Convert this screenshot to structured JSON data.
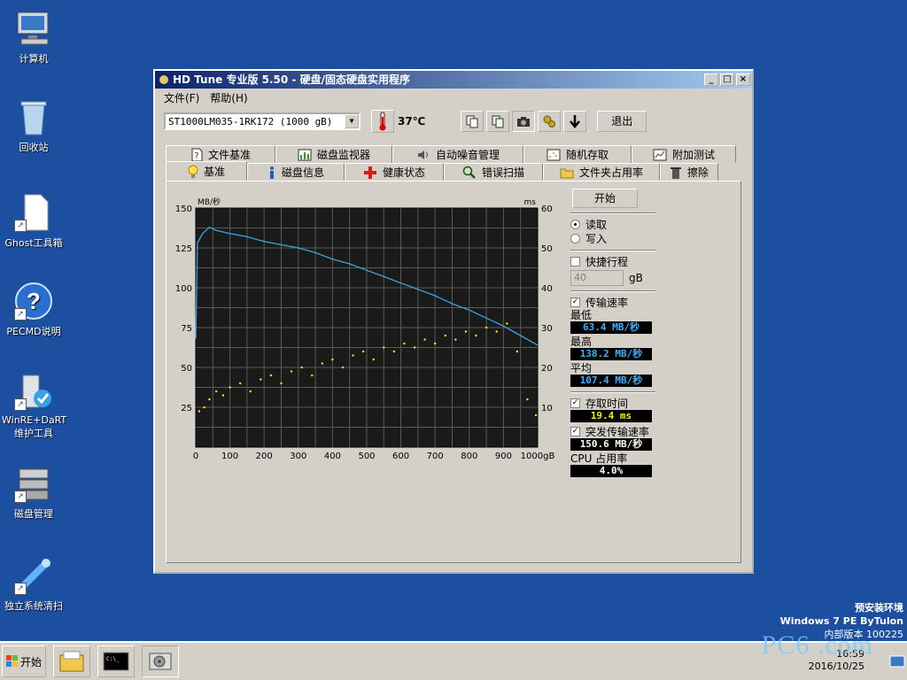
{
  "desktop": {
    "icons": [
      {
        "label": "计算机"
      },
      {
        "label": "回收站"
      },
      {
        "label": "Ghost工具箱"
      },
      {
        "label": "PECMD说明"
      },
      {
        "label": "WinRE+DaRT\n维护工具"
      },
      {
        "label": "磁盘管理"
      },
      {
        "label": "独立系统清扫"
      }
    ]
  },
  "window": {
    "title": "HD Tune 专业版 5.50 - 硬盘/固态硬盘实用程序",
    "menu": [
      "文件(F)",
      "帮助(H)"
    ],
    "drive": "ST1000LM035-1RK172 (1000 gB)",
    "temperature": "37℃",
    "exit_label": "退出",
    "tabs_row1": [
      "文件基准",
      "磁盘监视器",
      "自动噪音管理",
      "随机存取",
      "附加测试"
    ],
    "tabs_row2": [
      "基准",
      "磁盘信息",
      "健康状态",
      "错误扫描",
      "文件夹占用率",
      "擦除"
    ],
    "side": {
      "start_label": "开始",
      "read_label": "读取",
      "write_label": "写入",
      "quick_label": "快捷行程",
      "quick_value": "40",
      "quick_unit": "gB",
      "transfer_label": "传输速率",
      "min_label": "最低",
      "min_value": "63.4 MB/秒",
      "max_label": "最高",
      "max_value": "138.2 MB/秒",
      "avg_label": "平均",
      "avg_value": "107.4 MB/秒",
      "access_label": "存取时间",
      "access_value": "19.4 ms",
      "burst_label": "突发传输速率",
      "burst_value": "150.6 MB/秒",
      "cpu_label": "CPU 占用率",
      "cpu_value": "4.0%"
    }
  },
  "chart_data": {
    "type": "line",
    "ylabel": "MB/秒",
    "y2label": "ms",
    "xlabel": "",
    "x_ticks": [
      "0",
      "100",
      "200",
      "300",
      "400",
      "500",
      "600",
      "700",
      "800",
      "900",
      "1000gB"
    ],
    "y_ticks": [
      "25",
      "50",
      "75",
      "100",
      "125",
      "150"
    ],
    "y2_ticks": [
      "10",
      "20",
      "30",
      "40",
      "50",
      "60"
    ],
    "xlim": [
      0,
      1000
    ],
    "ylim": [
      0,
      150
    ],
    "y2lim": [
      0,
      60
    ],
    "grid": true,
    "series": [
      {
        "x": [
          0,
          5,
          20,
          40,
          60,
          100,
          150,
          200,
          250,
          300,
          350,
          400,
          450,
          500,
          550,
          600,
          650,
          700,
          750,
          800,
          850,
          900,
          950,
          1000
        ],
        "y": [
          68,
          128,
          134,
          138,
          136,
          134,
          132,
          129,
          127,
          125,
          122,
          118,
          115,
          111,
          107,
          103,
          99,
          95,
          90,
          86,
          81,
          76,
          70,
          64
        ],
        "color": "#3aa6e0"
      },
      {
        "x": [
          10,
          25,
          40,
          60,
          80,
          100,
          130,
          160,
          190,
          220,
          250,
          280,
          310,
          340,
          370,
          400,
          430,
          460,
          490,
          520,
          550,
          580,
          610,
          640,
          670,
          700,
          730,
          760,
          790,
          820,
          850,
          880,
          910,
          940,
          970,
          995
        ],
        "y": [
          9,
          10,
          12,
          14,
          13,
          15,
          16,
          14,
          17,
          18,
          16,
          19,
          20,
          18,
          21,
          22,
          20,
          23,
          24,
          22,
          25,
          24,
          26,
          25,
          27,
          26,
          28,
          27,
          29,
          28,
          30,
          29,
          31,
          24,
          12,
          8
        ],
        "color": "#ffe600",
        "axis": "y2",
        "style": "scatter"
      }
    ]
  },
  "taskbar": {
    "start_label": "开始",
    "clock_time": "16:59",
    "clock_date": "2016/10/25"
  },
  "env": {
    "line1": "预安装环境",
    "line2": "Windows 7 PE ByTulon",
    "line3": "内部版本 100225"
  },
  "colors": {
    "desktop": "#1d4fa0",
    "chart_bg": "#1a1a1a",
    "chart_grid": "#5a5a5a",
    "transfer_line": "#3aa6e0",
    "access_points": "#ffe600"
  }
}
